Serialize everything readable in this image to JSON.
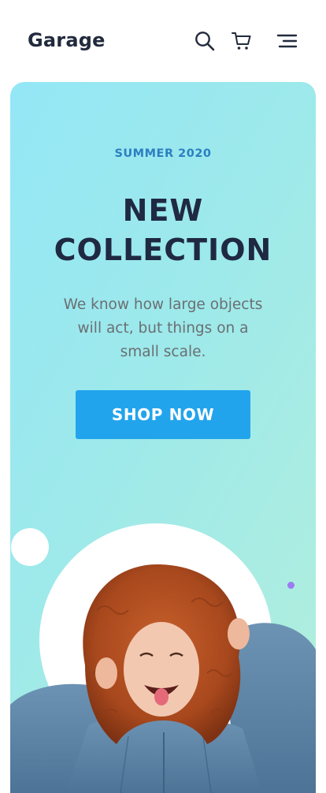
{
  "header": {
    "logo": "Garage",
    "icons": [
      "search-icon",
      "cart-icon",
      "menu-icon"
    ]
  },
  "hero": {
    "eyebrow": "SUMMER 2020",
    "headline_line1": "NEW",
    "headline_line2": "COLLECTION",
    "description_line1": "We know how large objects",
    "description_line2": "will act, but things on a",
    "description_line3": "small scale.",
    "cta_label": "SHOP NOW"
  },
  "colors": {
    "primary": "#22a4ed",
    "eyebrow": "#2c7fc0",
    "heading": "#1f2942",
    "accent_dot": "#9b7cf2"
  }
}
